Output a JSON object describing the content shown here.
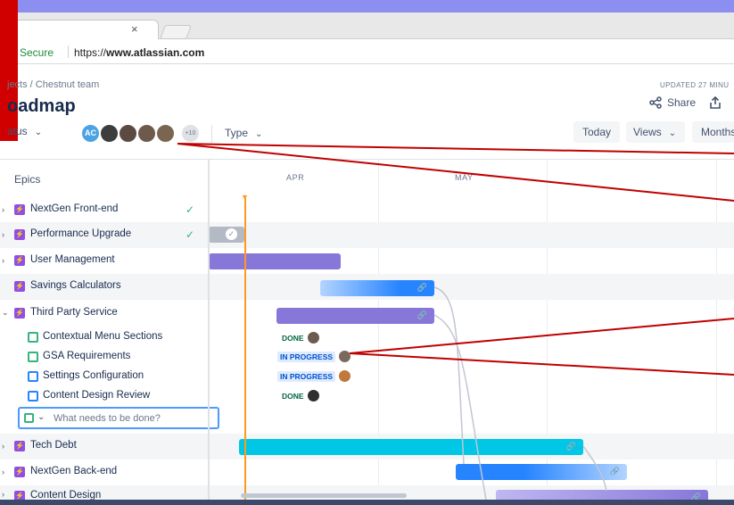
{
  "browser": {
    "url_secure": "Secure",
    "url_prefix": "https://",
    "url_domain": "www.atlassian.com",
    "tab_close": "×"
  },
  "page": {
    "breadcrumb": "jects / Chestnut team",
    "title": "oadmap",
    "updated": "UPDATED 27 MINU",
    "share_label": "Share"
  },
  "filters": {
    "status_label": "atus",
    "avatar_initials": "AC",
    "avatar_more": "+10",
    "type_label": "Type",
    "today_label": "Today",
    "views_label": "Views",
    "months_label": "Months"
  },
  "timeline": {
    "epics_header": "Epics",
    "months": [
      "APR",
      "MAY"
    ]
  },
  "epics": [
    {
      "label": "NextGen Front-end",
      "done": true
    },
    {
      "label": "Performance Upgrade",
      "done": true
    },
    {
      "label": "User Management",
      "done": false
    },
    {
      "label": "Savings Calculators",
      "done": false
    },
    {
      "label": "Third Party Service",
      "done": false
    }
  ],
  "children": [
    {
      "label": "Contextual Menu Sections",
      "status": "DONE",
      "type": "story"
    },
    {
      "label": "GSA Requirements",
      "status": "IN PROGRESS",
      "type": "story"
    },
    {
      "label": "Settings Configuration",
      "status": "IN PROGRESS",
      "type": "task"
    },
    {
      "label": "Content Design Review",
      "status": "DONE",
      "type": "task"
    }
  ],
  "new_issue": {
    "placeholder": "What needs to be done?"
  },
  "epics_bottom": [
    {
      "label": "Tech Debt"
    },
    {
      "label": "NextGen Back-end"
    },
    {
      "label": "Content Design"
    }
  ],
  "colors": {
    "epic_purple": "#904ee2",
    "bar_purple": "#8777d9",
    "bar_blue": "#2684ff",
    "bar_cyan": "#00c7e6",
    "done_green": "#36b37e",
    "today_orange": "#ff991f",
    "annotation_red": "#c00000"
  },
  "icons": {
    "share": "share-icon",
    "upload": "upload-icon",
    "link": "link-icon",
    "check": "check-icon",
    "chevron": "chevron-down-icon"
  }
}
